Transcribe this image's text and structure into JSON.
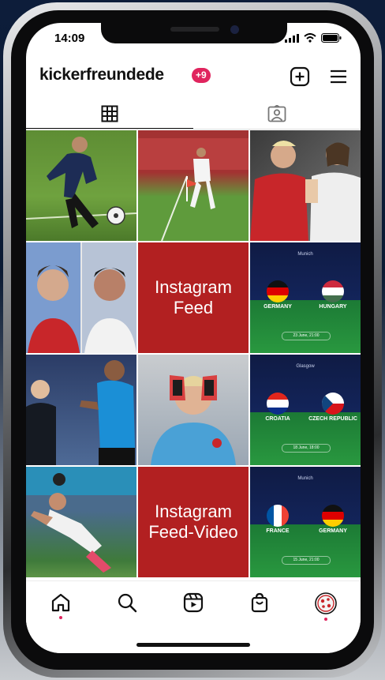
{
  "status_bar": {
    "time": "14:09"
  },
  "profile": {
    "username": "kickerfreundede",
    "notification_badge": "+9"
  },
  "header_icons": [
    "plus-square-icon",
    "hamburger-menu-icon"
  ],
  "tabs": [
    {
      "icon": "grid-icon",
      "selected": true
    },
    {
      "icon": "tagged-person-icon",
      "selected": false
    }
  ],
  "posts": [
    {
      "kind": "photo",
      "description": "coach kicking ball"
    },
    {
      "kind": "photo",
      "description": "player corner kick"
    },
    {
      "kind": "photo",
      "description": "two players confronting"
    },
    {
      "kind": "photo",
      "description": "two player portraits"
    },
    {
      "kind": "label",
      "text": "Instagram Feed"
    },
    {
      "kind": "match",
      "city": "Munich",
      "home": "GERMANY",
      "away": "HUNGARY",
      "date": "23 June, 21:00"
    },
    {
      "kind": "photo",
      "description": "player and referee"
    },
    {
      "kind": "photo",
      "description": "goalkeeper with gloves on face"
    },
    {
      "kind": "match",
      "city": "Glasgow",
      "home": "CROATIA",
      "away": "CZECH REPUBLIC",
      "date": "18 June, 18:00"
    },
    {
      "kind": "photo",
      "description": "player kneeling celebrating"
    },
    {
      "kind": "label",
      "text": "Instagram Feed-Video"
    },
    {
      "kind": "match",
      "city": "Munich",
      "home": "FRANCE",
      "away": "GERMANY",
      "date": "15 June, 21:00"
    }
  ],
  "bottom_nav": [
    {
      "icon": "home-icon",
      "active": true
    },
    {
      "icon": "search-icon",
      "active": false
    },
    {
      "icon": "reels-icon",
      "active": false
    },
    {
      "icon": "shopping-bag-icon",
      "active": false
    },
    {
      "icon": "profile-avatar-icon",
      "active": true
    }
  ],
  "colors": {
    "brand_red": "#b22021",
    "badge_pink": "#e0245e",
    "match_navy": "#13245a",
    "pitch_green": "#29983f"
  }
}
